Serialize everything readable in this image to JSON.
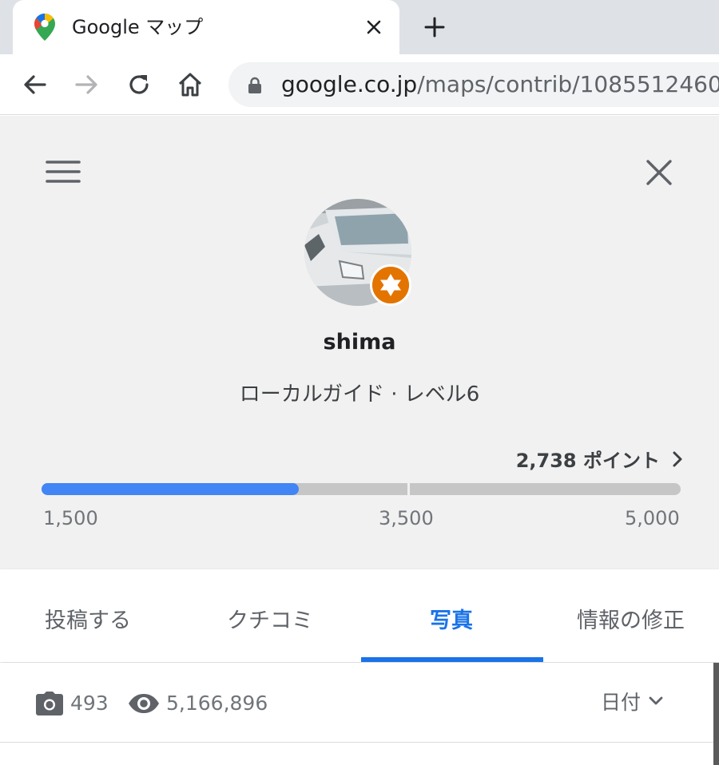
{
  "browser": {
    "tab_title": "Google マップ",
    "url_host": "google.co.jp",
    "url_path": "/maps/contrib/1085512460"
  },
  "profile": {
    "name": "shima",
    "level_text": "ローカルガイド · レベル6",
    "points_text": "2,738 ポイント",
    "progress": {
      "min": 1500,
      "max": 5000,
      "value": 2738,
      "mid": 3500
    },
    "ticks": [
      "1,500",
      "3,500",
      "5,000"
    ]
  },
  "tabs": [
    {
      "label": "投稿する",
      "active": false
    },
    {
      "label": "クチコミ",
      "active": false
    },
    {
      "label": "写真",
      "active": true
    },
    {
      "label": "情報の修正",
      "active": false
    }
  ],
  "stats": {
    "photos": "493",
    "views": "5,166,896",
    "sort_label": "日付"
  },
  "colors": {
    "accent": "#1a73e8",
    "progress_fill": "#4285f4",
    "badge": "#e37400"
  }
}
